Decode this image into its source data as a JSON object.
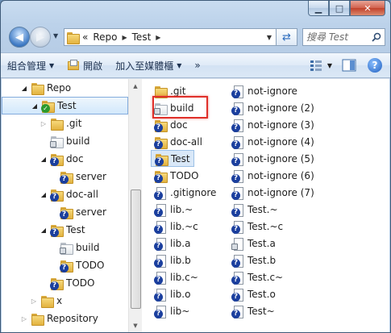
{
  "window": {
    "caption_buttons": {
      "minimize": "▁",
      "maximize": "□",
      "close": "✕"
    }
  },
  "address": {
    "overflow": "«",
    "crumbs": [
      "Repo",
      "Test"
    ],
    "search_placeholder": "搜尋 Test"
  },
  "toolbar": {
    "organize": "組合管理",
    "open": "開啟",
    "add_to_library": "加入至媒體櫃",
    "more": "»"
  },
  "tree": [
    {
      "label": "Repo",
      "level": 1,
      "state": "open",
      "icon": "folder-icon",
      "badge": ""
    },
    {
      "label": "Test",
      "level": 2,
      "state": "open",
      "icon": "folder-icon",
      "badge": "check",
      "selected": true
    },
    {
      "label": ".git",
      "level": 3,
      "state": "closed",
      "icon": "folder-icon",
      "badge": ""
    },
    {
      "label": "build",
      "level": 3,
      "state": "none",
      "icon": "folder-icon",
      "badge": "lock",
      "variant": "white"
    },
    {
      "label": "doc",
      "level": 3,
      "state": "open",
      "icon": "folder-icon",
      "badge": "question"
    },
    {
      "label": "server",
      "level": 4,
      "state": "none",
      "icon": "folder-icon",
      "badge": "question"
    },
    {
      "label": "doc-all",
      "level": 3,
      "state": "open",
      "icon": "folder-icon",
      "badge": "question"
    },
    {
      "label": "server",
      "level": 4,
      "state": "none",
      "icon": "folder-icon",
      "badge": "question"
    },
    {
      "label": "Test",
      "level": 3,
      "state": "open",
      "icon": "folder-icon",
      "badge": "question"
    },
    {
      "label": "build",
      "level": 4,
      "state": "none",
      "icon": "folder-icon",
      "badge": "lock",
      "variant": "white"
    },
    {
      "label": "TODO",
      "level": 4,
      "state": "none",
      "icon": "folder-icon",
      "badge": "question"
    },
    {
      "label": "TODO",
      "level": 3,
      "state": "none",
      "icon": "folder-icon",
      "badge": "question"
    },
    {
      "label": "x",
      "level": 2,
      "state": "closed",
      "icon": "folder-icon",
      "badge": ""
    },
    {
      "label": "Repository",
      "level": 1,
      "state": "closed",
      "icon": "folder-icon",
      "badge": ""
    }
  ],
  "files_col1": [
    {
      "label": ".git",
      "icon": "folder-icon",
      "badge": ""
    },
    {
      "label": "build",
      "icon": "folder-icon",
      "badge": "lock",
      "variant": "white"
    },
    {
      "label": "doc",
      "icon": "folder-icon",
      "badge": "question"
    },
    {
      "label": "doc-all",
      "icon": "folder-icon",
      "badge": "question"
    },
    {
      "label": "Test",
      "icon": "folder-icon",
      "badge": "question",
      "selected": true
    },
    {
      "label": "TODO",
      "icon": "folder-icon",
      "badge": "question"
    },
    {
      "label": ".gitignore",
      "icon": "file-icon",
      "badge": "question"
    },
    {
      "label": "lib.~",
      "icon": "file-icon",
      "badge": "question"
    },
    {
      "label": "lib.~c",
      "icon": "file-icon",
      "badge": "question"
    },
    {
      "label": "lib.a",
      "icon": "file-icon",
      "badge": "question"
    },
    {
      "label": "lib.b",
      "icon": "file-icon",
      "badge": "question"
    },
    {
      "label": "lib.c~",
      "icon": "file-icon",
      "badge": "question"
    },
    {
      "label": "lib.o",
      "icon": "file-icon",
      "badge": "question"
    },
    {
      "label": "lib~",
      "icon": "file-icon",
      "badge": "question"
    }
  ],
  "files_col2": [
    {
      "label": "not-ignore",
      "icon": "file-icon",
      "badge": "question"
    },
    {
      "label": "not-ignore (2)",
      "icon": "file-icon",
      "badge": "question"
    },
    {
      "label": "not-ignore (3)",
      "icon": "file-icon",
      "badge": "question"
    },
    {
      "label": "not-ignore (4)",
      "icon": "file-icon",
      "badge": "question"
    },
    {
      "label": "not-ignore (5)",
      "icon": "file-icon",
      "badge": "question"
    },
    {
      "label": "not-ignore (6)",
      "icon": "file-icon",
      "badge": "question"
    },
    {
      "label": "not-ignore (7)",
      "icon": "file-icon",
      "badge": "question"
    },
    {
      "label": "Test.~",
      "icon": "file-icon",
      "badge": "question"
    },
    {
      "label": "Test.~c",
      "icon": "file-icon",
      "badge": "question"
    },
    {
      "label": "Test.a",
      "icon": "file-icon",
      "badge": "lock"
    },
    {
      "label": "Test.b",
      "icon": "file-icon",
      "badge": "question"
    },
    {
      "label": "Test.c~",
      "icon": "file-icon",
      "badge": "question"
    },
    {
      "label": "Test.o",
      "icon": "file-icon",
      "badge": "question"
    },
    {
      "label": "Test~",
      "icon": "file-icon",
      "badge": "question"
    }
  ],
  "colors": {
    "highlight": "#e0302a",
    "selection": "#d9e8f8",
    "accent": "#1f5fc0"
  }
}
